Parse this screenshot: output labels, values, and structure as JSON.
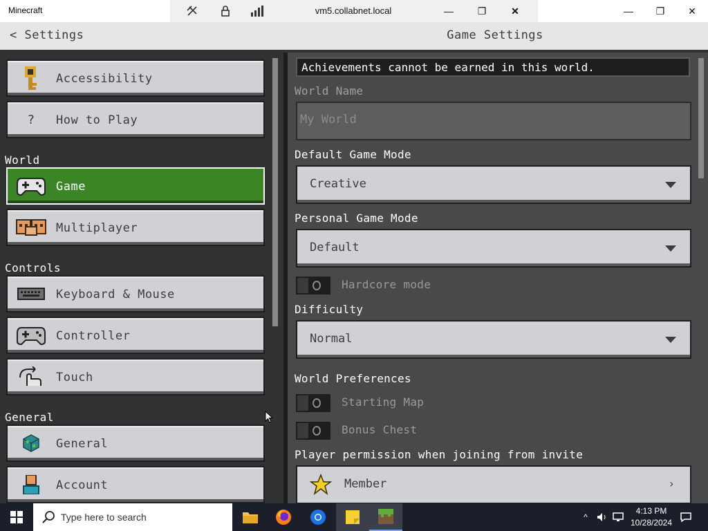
{
  "window": {
    "app_title": "Minecraft",
    "remote_host": "vm5.collabnet.local",
    "minimize": "—",
    "restore": "❐",
    "close": "✕"
  },
  "header": {
    "back_label": "Settings",
    "back_chevron": "<",
    "title": "Game Settings"
  },
  "sidebar": {
    "sections": {
      "world": "World",
      "controls": "Controls",
      "general": "General"
    },
    "items": [
      {
        "label": "Accessibility",
        "icon": "key-icon"
      },
      {
        "label": "How to Play",
        "icon": "question-icon",
        "glyph": "?"
      },
      {
        "label": "Game",
        "icon": "gamepad-icon",
        "selected": true
      },
      {
        "label": "Multiplayer",
        "icon": "players-icon"
      },
      {
        "label": "Keyboard & Mouse",
        "icon": "keyboard-icon"
      },
      {
        "label": "Controller",
        "icon": "controller-icon"
      },
      {
        "label": "Touch",
        "icon": "touch-icon"
      },
      {
        "label": "General",
        "icon": "globe-cube-icon"
      },
      {
        "label": "Account",
        "icon": "account-icon"
      }
    ]
  },
  "game_settings": {
    "notice": "Achievements cannot be earned in this world.",
    "world_name_label": "World Name",
    "world_name_value": "My World",
    "default_game_mode_label": "Default Game Mode",
    "default_game_mode_value": "Creative",
    "personal_game_mode_label": "Personal Game Mode",
    "personal_game_mode_value": "Default",
    "hardcore_label": "Hardcore mode",
    "difficulty_label": "Difficulty",
    "difficulty_value": "Normal",
    "world_preferences_label": "World Preferences",
    "starting_map_label": "Starting Map",
    "bonus_chest_label": "Bonus Chest",
    "player_permission_label": "Player permission when joining from invite",
    "player_permission_value": "Member"
  },
  "taskbar": {
    "search_placeholder": "Type here to search",
    "time": "4:13 PM",
    "date": "10/28/2024"
  },
  "colors": {
    "accent_green": "#3c8527",
    "button_gray": "#d0d1d4",
    "panel_dark": "#313233",
    "panel_right": "#48494a"
  }
}
